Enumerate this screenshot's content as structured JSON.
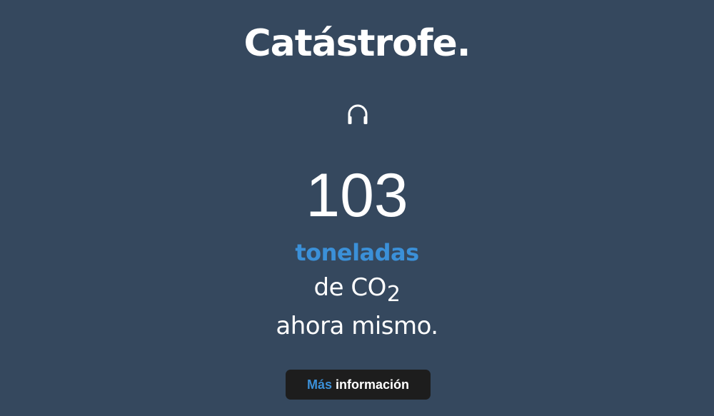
{
  "header": {
    "title": "Catástrofe."
  },
  "sound_button": {
    "icon": "headphones-icon"
  },
  "counter": {
    "value": "103",
    "unit": "toneladas",
    "line2_prefix": "de CO",
    "line2_subscript": "2",
    "line3": "ahora mismo."
  },
  "more_button": {
    "accent_label": "Más",
    "label": "información"
  },
  "colors": {
    "background": "#35485e",
    "accent": "#3b90d8",
    "text": "#ffffff",
    "button_bg": "#1d1d1d"
  }
}
